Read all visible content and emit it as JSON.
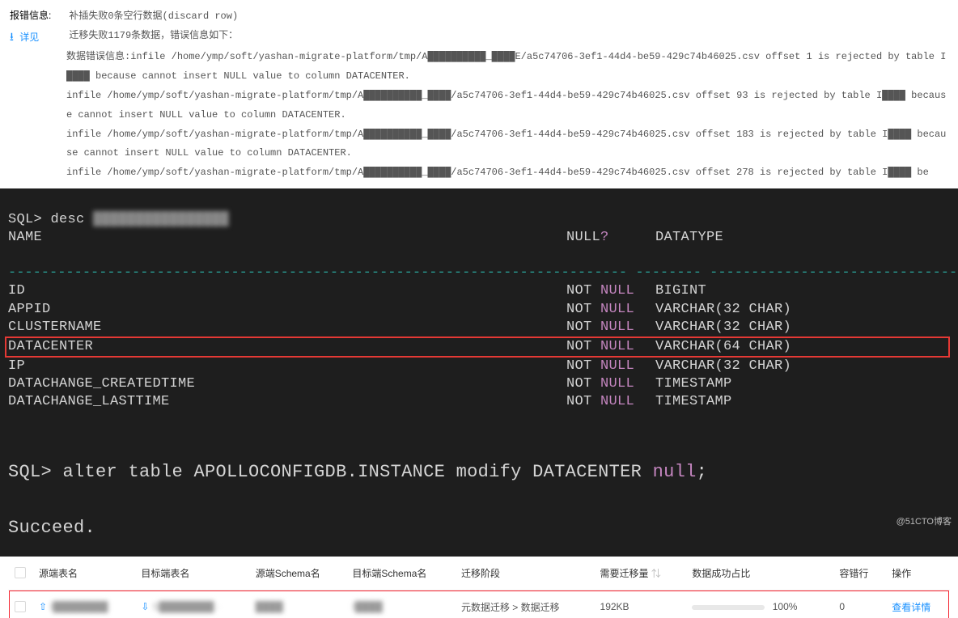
{
  "log": {
    "error_label": "报错信息:",
    "summary1": "补插失败0条空行数据(discard row)",
    "details_label": "详见",
    "summary2": "迁移失败1179条数据，错误信息如下：",
    "line_prefix": "数据错误信息:",
    "lines": [
      "infile /home/ymp/soft/yashan-migrate-platform/tmp/A██████████_████E/a5c74706-3ef1-44d4-be59-429c74b46025.csv offset 1 is rejected by table I████ because cannot insert NULL value to column DATACENTER.",
      "infile /home/ymp/soft/yashan-migrate-platform/tmp/A██████████_████/a5c74706-3ef1-44d4-be59-429c74b46025.csv offset 93 is rejected by table I████ because cannot insert NULL value to column DATACENTER.",
      "infile /home/ymp/soft/yashan-migrate-platform/tmp/A██████████_████/a5c74706-3ef1-44d4-be59-429c74b46025.csv offset 183 is rejected by table I████ because cannot insert NULL value to column DATACENTER.",
      "infile /home/ymp/soft/yashan-migrate-platform/tmp/A██████████_████/a5c74706-3ef1-44d4-be59-429c74b46025.csv offset 278 is rejected by table I████ be"
    ]
  },
  "terminal": {
    "desc_cmd": "SQL> desc ",
    "desc_target": "████████████████",
    "hdr_name": "NAME",
    "hdr_null": "NULL",
    "hdr_nullq": "?",
    "hdr_type": "DATATYPE",
    "dashes": "--------------------------------------------------------------------------- -------- ----------------------------------------------",
    "rows": [
      {
        "name": "ID",
        "null": "NOT NULL",
        "type": "BIGINT",
        "hl": false
      },
      {
        "name": "APPID",
        "null": "NOT NULL",
        "type": "VARCHAR(32 CHAR)",
        "hl": false
      },
      {
        "name": "CLUSTERNAME",
        "null": "NOT NULL",
        "type": "VARCHAR(32 CHAR)",
        "hl": false
      },
      {
        "name": "DATACENTER",
        "null": "NOT NULL",
        "type": "VARCHAR(64 CHAR)",
        "hl": true
      },
      {
        "name": "IP",
        "null": "NOT NULL",
        "type": "VARCHAR(32 CHAR)",
        "hl": false
      },
      {
        "name": "DATACHANGE_CREATEDTIME",
        "null": "NOT NULL",
        "type": "TIMESTAMP",
        "hl": false
      },
      {
        "name": "DATACHANGE_LASTTIME",
        "null": "NOT NULL",
        "type": "TIMESTAMP",
        "hl": false
      }
    ],
    "alter_pre": "SQL> alter table APOLLOCONFIGDB.INSTANCE modify DATACENTER ",
    "alter_null": "null",
    "alter_post": ";",
    "succeed": "Succeed."
  },
  "table": {
    "headers": {
      "src_table": "源端表名",
      "dst_table": "目标端表名",
      "src_schema": "源端Schema名",
      "dst_schema": "目标端Schema名",
      "phase": "迁移阶段",
      "need": "需要迁移量",
      "success_ratio": "数据成功占比",
      "fault": "容错行",
      "op": "操作"
    },
    "row": {
      "src_table": "I████████",
      "dst_table": "S████████ ·",
      "src_schema": "████",
      "dst_schema": "I████",
      "phase": "元数据迁移 > 数据迁移",
      "need": "192KB",
      "ratio_pct": "100%",
      "fault": "0",
      "op": "查看详情"
    }
  },
  "watermark": "@51CTO博客"
}
